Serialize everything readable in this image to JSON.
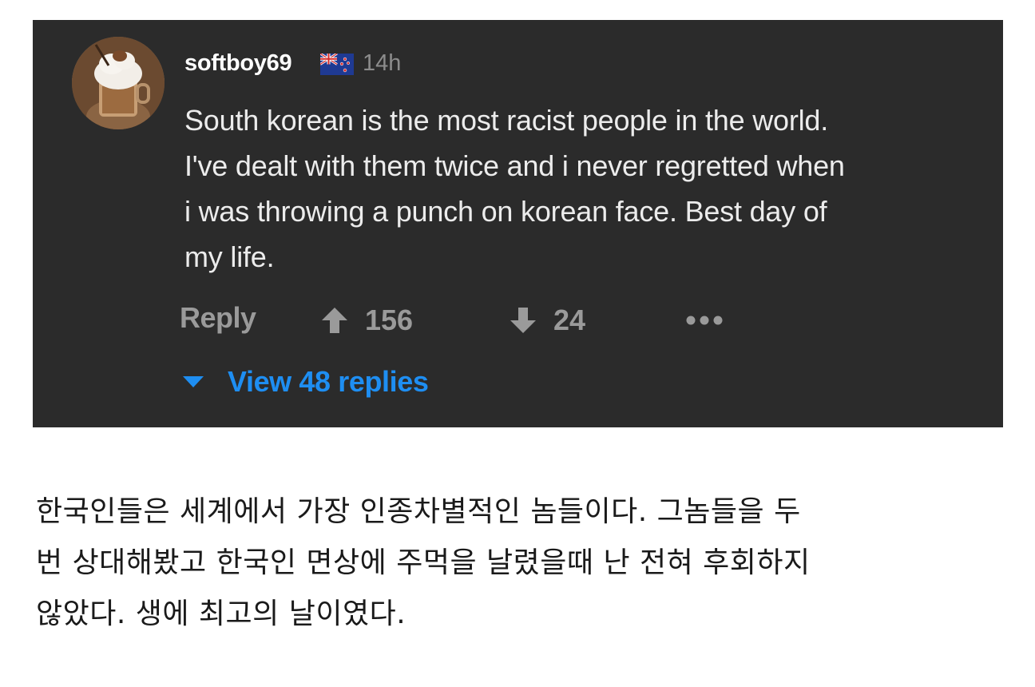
{
  "comment": {
    "username": "softboy69",
    "flag_icon": "new-zealand-flag-icon",
    "time": "14h",
    "text_lines": [
      "South korean is the most racist people in the world.",
      "I've dealt with them twice and i never regretted when",
      "i was throwing a punch on korean face. Best day of",
      "my life."
    ],
    "actions": {
      "reply_label": "Reply",
      "upvote_count": "156",
      "downvote_count": "24",
      "more_icon": "more-dots-icon"
    },
    "view_replies_label": "View 48 replies",
    "colors": {
      "card_bg": "#2b2b2b",
      "text": "#ececec",
      "muted": "#9a9a9a",
      "link": "#1e8ef2"
    }
  },
  "translation": {
    "lines": [
      "한국인들은 세계에서 가장 인종차별적인 놈들이다. 그놈들을 두",
      "번 상대해봤고 한국인 면상에 주먹을 날렸을때 난 전혀 후회하지",
      "않았다. 생에 최고의 날이였다."
    ]
  }
}
